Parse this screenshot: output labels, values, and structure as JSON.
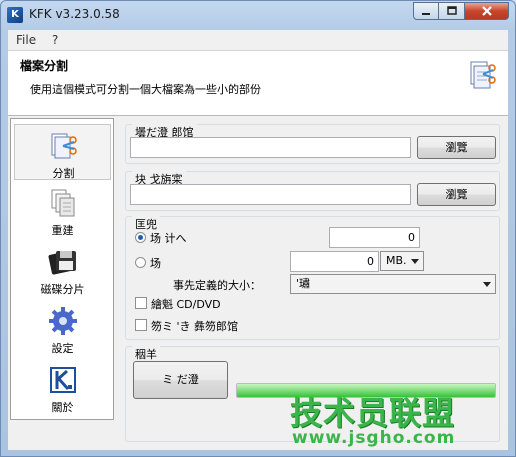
{
  "window": {
    "title": "KFK v3.23.0.58",
    "app_icon": "K",
    "controls": {
      "minimize": "minimize-icon",
      "maximize": "maximize-icon",
      "close": "close-icon"
    }
  },
  "menu": {
    "items": [
      "File",
      "?"
    ]
  },
  "header": {
    "title": "檔案分割",
    "description": "使用這個模式可分割一個大檔案為一些小的部份"
  },
  "sidebar": {
    "items": [
      {
        "label": "分割",
        "icon": "split-file-icon",
        "active": true
      },
      {
        "label": "重建",
        "icon": "rebuild-icon",
        "active": false
      },
      {
        "label": "磁碟分片",
        "icon": "floppy-disk-icon",
        "active": false
      },
      {
        "label": "設定",
        "icon": "gear-icon",
        "active": false
      },
      {
        "label": "關於",
        "icon": "kfk-logo-icon",
        "active": false
      }
    ]
  },
  "source_group": {
    "title": "壜だ澄  郎馆",
    "value": "",
    "button": "瀏覽"
  },
  "dest_group": {
    "title": "块  戈旃寀",
    "value": "",
    "button": "瀏覽"
  },
  "options_group": {
    "title": "匡兜",
    "opt1": {
      "label": "场      计へ",
      "value": "0",
      "checked": true
    },
    "opt2": {
      "label": "场",
      "value": "0",
      "unit": "MB.",
      "checked": false
    },
    "preset_label": "事先定義的大小：",
    "preset_value": "'璛",
    "check1_label": "繪魁    CD/DVD",
    "check2_label": "笏ミ 'き  彝笏郎馆"
  },
  "action_group": {
    "title": "秵羊",
    "button": "ミ  だ澄",
    "progress": 1.0
  },
  "watermark": {
    "line1": "技术员联盟",
    "line2": "www.jsgho.com"
  },
  "colors": {
    "accent": "#1a5fb4",
    "watermark": "#39b54a",
    "progress": "#37c23a"
  }
}
